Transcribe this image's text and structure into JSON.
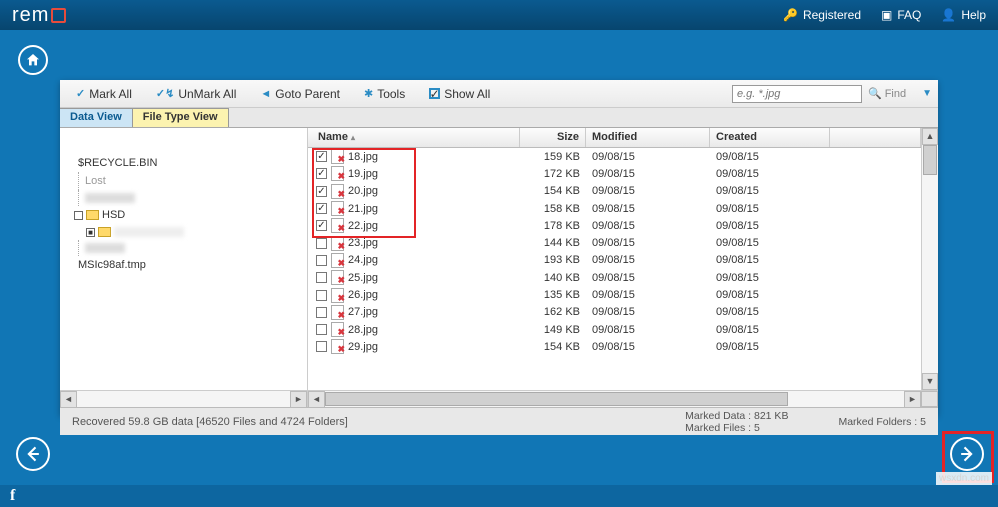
{
  "brand": "rem",
  "header": {
    "registered": "Registered",
    "faq": "FAQ",
    "help": "Help"
  },
  "toolbar": {
    "markAll": "Mark All",
    "unmarkAll": "UnMark All",
    "gotoParent": "Goto Parent",
    "tools": "Tools",
    "showAll": "Show All",
    "searchPlaceholder": "e.g. *.jpg",
    "find": "Find"
  },
  "tabs": {
    "dataView": "Data View",
    "fileTypeView": "File Type View"
  },
  "tree": {
    "items": [
      {
        "label": "$RECYCLE.BIN"
      },
      {
        "label": "Lost"
      },
      {
        "label": "HSD"
      },
      {
        "label": "MSIc98af.tmp"
      }
    ]
  },
  "columns": {
    "name": "Name",
    "size": "Size",
    "modified": "Modified",
    "created": "Created"
  },
  "files": [
    {
      "checked": true,
      "name": "18.jpg",
      "size": "159 KB",
      "modified": "09/08/15",
      "created": "09/08/15"
    },
    {
      "checked": true,
      "name": "19.jpg",
      "size": "172 KB",
      "modified": "09/08/15",
      "created": "09/08/15"
    },
    {
      "checked": true,
      "name": "20.jpg",
      "size": "154 KB",
      "modified": "09/08/15",
      "created": "09/08/15"
    },
    {
      "checked": true,
      "name": "21.jpg",
      "size": "158 KB",
      "modified": "09/08/15",
      "created": "09/08/15"
    },
    {
      "checked": true,
      "name": "22.jpg",
      "size": "178 KB",
      "modified": "09/08/15",
      "created": "09/08/15"
    },
    {
      "checked": false,
      "name": "23.jpg",
      "size": "144 KB",
      "modified": "09/08/15",
      "created": "09/08/15"
    },
    {
      "checked": false,
      "name": "24.jpg",
      "size": "193 KB",
      "modified": "09/08/15",
      "created": "09/08/15"
    },
    {
      "checked": false,
      "name": "25.jpg",
      "size": "140 KB",
      "modified": "09/08/15",
      "created": "09/08/15"
    },
    {
      "checked": false,
      "name": "26.jpg",
      "size": "135 KB",
      "modified": "09/08/15",
      "created": "09/08/15"
    },
    {
      "checked": false,
      "name": "27.jpg",
      "size": "162 KB",
      "modified": "09/08/15",
      "created": "09/08/15"
    },
    {
      "checked": false,
      "name": "28.jpg",
      "size": "149 KB",
      "modified": "09/08/15",
      "created": "09/08/15"
    },
    {
      "checked": false,
      "name": "29.jpg",
      "size": "154 KB",
      "modified": "09/08/15",
      "created": "09/08/15"
    }
  ],
  "status": {
    "recovered": "Recovered 59.8 GB data [46520 Files and 4724 Folders]",
    "markedData": "Marked Data : 821 KB",
    "markedFiles": "Marked Files : 5",
    "markedFolders": "Marked Folders : 5"
  },
  "watermark": "wsxdn.com"
}
